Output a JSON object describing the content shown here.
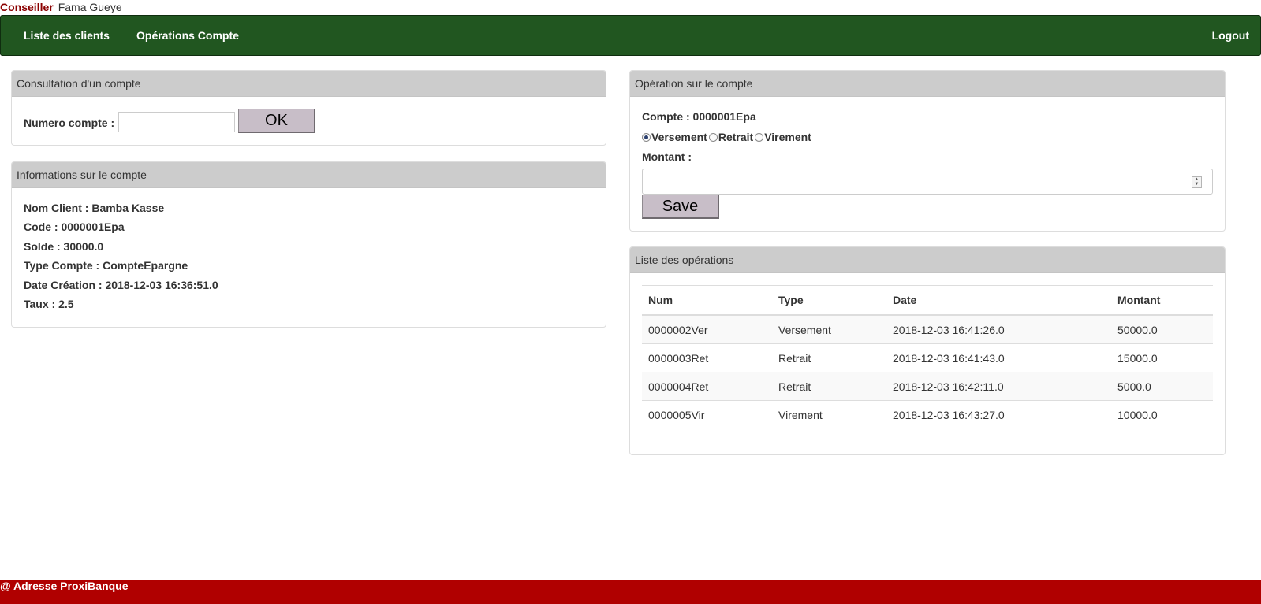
{
  "topbar": {
    "role": "Conseiller",
    "user": "Fama Gueye"
  },
  "nav": {
    "links": [
      "Liste des clients",
      "Opérations Compte"
    ],
    "logout": "Logout"
  },
  "consultation": {
    "heading": "Consultation d'un compte",
    "label": "Numero compte :",
    "input_value": "",
    "button": "OK"
  },
  "informations": {
    "heading": "Informations sur le compte",
    "lines": [
      "Nom Client : Bamba Kasse",
      "Code : 0000001Epa",
      "Solde : 30000.0",
      "Type Compte : CompteEpargne",
      "Date Création : 2018-12-03 16:36:51.0",
      "Taux : 2.5"
    ]
  },
  "operation": {
    "heading": "Opération sur le compte",
    "compte": "Compte : 0000001Epa",
    "radios": [
      "Versement",
      "Retrait",
      "Virement"
    ],
    "selected": "Versement",
    "montant_label": "Montant :",
    "montant_value": "",
    "save": "Save",
    "spin_up": "▲",
    "spin_down": "▼"
  },
  "liste": {
    "heading": "Liste des opérations",
    "columns": [
      "Num",
      "Type",
      "Date",
      "Montant"
    ],
    "rows": [
      [
        "0000002Ver",
        "Versement",
        "2018-12-03 16:41:26.0",
        "50000.0"
      ],
      [
        "0000003Ret",
        "Retrait",
        "2018-12-03 16:41:43.0",
        "15000.0"
      ],
      [
        "0000004Ret",
        "Retrait",
        "2018-12-03 16:42:11.0",
        "5000.0"
      ],
      [
        "0000005Vir",
        "Virement",
        "2018-12-03 16:43:27.0",
        "10000.0"
      ]
    ]
  },
  "footer": {
    "text": "@ Adresse ProxiBanque"
  },
  "colors": {
    "navbar": "#215620",
    "footer": "#b00000",
    "role": "#8b0000",
    "panel_heading": "#cccccc",
    "button": "#c8bec8"
  }
}
